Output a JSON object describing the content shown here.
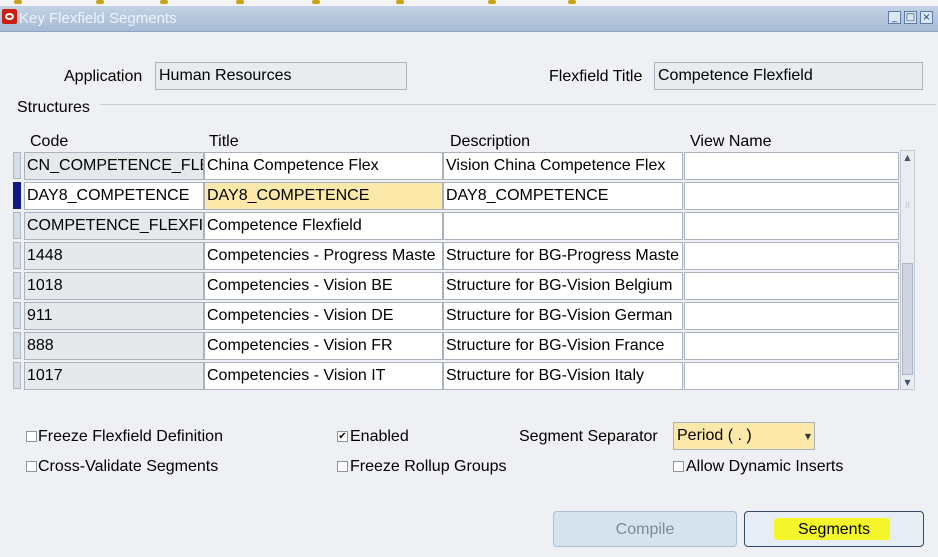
{
  "window": {
    "title": "Key Flexfield Segments"
  },
  "header": {
    "application_label": "Application",
    "application_value": "Human Resources",
    "flexfield_title_label": "Flexfield Title",
    "flexfield_title_value": "Competence Flexfield"
  },
  "structures": {
    "section_label": "Structures",
    "columns": [
      "Code",
      "Title",
      "Description",
      "View Name"
    ],
    "rows": [
      {
        "code": "CN_COMPETENCE_FLE",
        "title": "China Competence Flex",
        "description": "Vision China Competence Flex",
        "view_name": ""
      },
      {
        "code": "DAY8_COMPETENCE",
        "title": "DAY8_COMPETENCE",
        "description": "DAY8_COMPETENCE",
        "view_name": ""
      },
      {
        "code": "COMPETENCE_FLEXFI",
        "title": "Competence Flexfield",
        "description": "",
        "view_name": ""
      },
      {
        "code": "1448",
        "title": "Competencies - Progress Maste",
        "description": "Structure for BG-Progress Maste",
        "view_name": ""
      },
      {
        "code": "1018",
        "title": "Competencies - Vision BE",
        "description": "Structure for BG-Vision Belgium",
        "view_name": ""
      },
      {
        "code": "911",
        "title": "Competencies - Vision DE",
        "description": "Structure for BG-Vision German",
        "view_name": ""
      },
      {
        "code": "888",
        "title": "Competencies - Vision FR",
        "description": "Structure for BG-Vision France",
        "view_name": ""
      },
      {
        "code": "1017",
        "title": "Competencies - Vision IT",
        "description": "Structure for BG-Vision Italy",
        "view_name": ""
      }
    ]
  },
  "options": {
    "freeze_flexfield_definition": {
      "label": "Freeze Flexfield Definition",
      "checked": false
    },
    "enabled": {
      "label": "Enabled",
      "checked": true
    },
    "cross_validate_segments": {
      "label": "Cross-Validate Segments",
      "checked": false
    },
    "freeze_rollup_groups": {
      "label": "Freeze Rollup Groups",
      "checked": false
    },
    "allow_dynamic_inserts": {
      "label": "Allow Dynamic Inserts",
      "checked": false
    },
    "segment_separator_label": "Segment Separator",
    "segment_separator_value": "Period ( . )",
    "checkmark": "✔"
  },
  "buttons": {
    "compile": "Compile",
    "segments": "Segments"
  },
  "colors": {
    "active_row_indicator": "#0f1b82",
    "highlight_field": "#fce9a9",
    "segments_highlight": "#f4f51f"
  }
}
